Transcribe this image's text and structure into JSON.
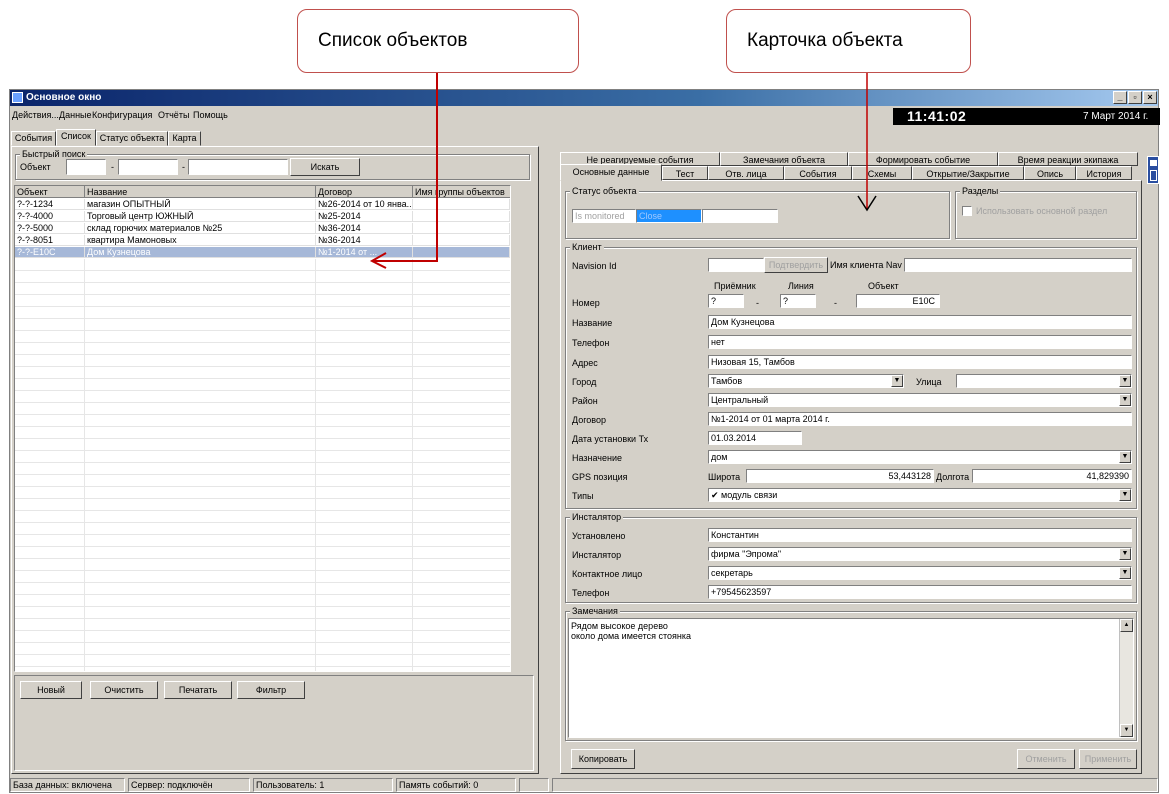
{
  "callouts": {
    "list": "Список объектов",
    "card": "Карточка объекта"
  },
  "window": {
    "title": "Основное окно",
    "controls": [
      "_",
      "▫",
      "×"
    ]
  },
  "menu": [
    "Действия...",
    "Данные",
    "Конфигурация",
    "Отчёты",
    "Помощь"
  ],
  "clock": {
    "time": "11:41:02",
    "date": "7 Март 2014 г."
  },
  "left_tabs": [
    "События",
    "Список",
    "Статус объекта",
    "Карта"
  ],
  "quick_search": {
    "title": "Быстрый поиск",
    "label": "Объект",
    "sep1": "-",
    "sep2": "-",
    "button": "Искать"
  },
  "grid": {
    "columns": [
      "Объект",
      "Название",
      "Договор",
      "Имя группы объектов"
    ],
    "rows": [
      [
        "?-?-1234",
        "магазин ОПЫТНЫЙ",
        "№26-2014 от 10 янва...",
        ""
      ],
      [
        "?-?-4000",
        "Торговый центр ЮЖНЫЙ",
        "№25-2014",
        ""
      ],
      [
        "?-?-5000",
        "склад горючих материалов №25",
        "№36-2014",
        ""
      ],
      [
        "?-?-8051",
        "квартира Мамоновых",
        "№36-2014",
        ""
      ],
      [
        "?-?-E10C",
        "Дом Кузнецова",
        "№1-2014 от ...",
        ""
      ]
    ],
    "selected_index": 4
  },
  "left_buttons": [
    "Новый",
    "Очистить",
    "Печатать",
    "Фильтр"
  ],
  "right_tabs_row1": [
    "Не реагируемые события",
    "Замечания объекта",
    "Формировать событие",
    "Время реакции экипажа"
  ],
  "right_tabs_row2": [
    "Основные данные",
    "Тест",
    "Отв. лица",
    "События",
    "Схемы",
    "Открытие/Закрытие",
    "Опись",
    "История"
  ],
  "status_group": {
    "title": "Статус объекта",
    "monitored": "Is monitored",
    "close": "Close",
    "empty": ""
  },
  "sections_group": {
    "title": "Разделы",
    "checkbox_label": "Использовать основной раздел"
  },
  "client": {
    "title": "Клиент",
    "navision_label": "Navision Id",
    "navision_value": "",
    "confirm_button": "Подтвердить",
    "nav_name_label": "Имя клиента Nav",
    "nav_name_value": "",
    "receiver_label": "Приёмник",
    "line_label": "Линия",
    "object_label": "Объект",
    "number_label": "Номер",
    "receiver_value": "?",
    "line_value": "?",
    "num_sep1": "-",
    "num_sep2": "-",
    "object_value": "E10C",
    "name_label": "Название",
    "name_value": "Дом Кузнецова",
    "phone_label": "Телефон",
    "phone_value": "нет",
    "address_label": "Адрес",
    "address_value": "Низовая 15, Тамбов",
    "city_label": "Город",
    "city_value": "Тамбов",
    "street_label": "Улица",
    "street_value": "",
    "district_label": "Район",
    "district_value": "Центральный",
    "contract_label": "Договор",
    "contract_value": "№1-2014 от 01 марта 2014 г.",
    "install_date_label": "Дата установки Тх",
    "install_date_value": "01.03.2014",
    "purpose_label": "Назначение",
    "purpose_value": "дом",
    "gps_label": "GPS позиция",
    "lat_label": "Широта",
    "lat_value": "53,443128",
    "lon_label": "Долгота",
    "lon_value": "41,829390",
    "types_label": "Типы",
    "types_value": "✔ модуль связи"
  },
  "installer": {
    "title": "Инсталятор",
    "installed_label": "Установлено",
    "installed_value": "Константин",
    "installer_label": "Инсталятор",
    "installer_value": "фирма \"Эпрома\"",
    "contact_label": "Контактное лицо",
    "contact_value": "секретарь",
    "phone_label": "Телефон",
    "phone_value": "+79545623597"
  },
  "notes": {
    "title": "Замечания",
    "line1": "Рядом высокое дерево",
    "line2": "около дома имеется стоянка"
  },
  "right_buttons": {
    "copy": "Копировать",
    "cancel": "Отменить",
    "apply": "Применить"
  },
  "statusbar": [
    "База данных: включена",
    "Сервер: подключён",
    "Пользователь: 1",
    "Память событий: 0"
  ],
  "colors": {
    "callout_border": "#c0504d",
    "arrow": "#c00000",
    "selection": "#a6b8d8"
  }
}
